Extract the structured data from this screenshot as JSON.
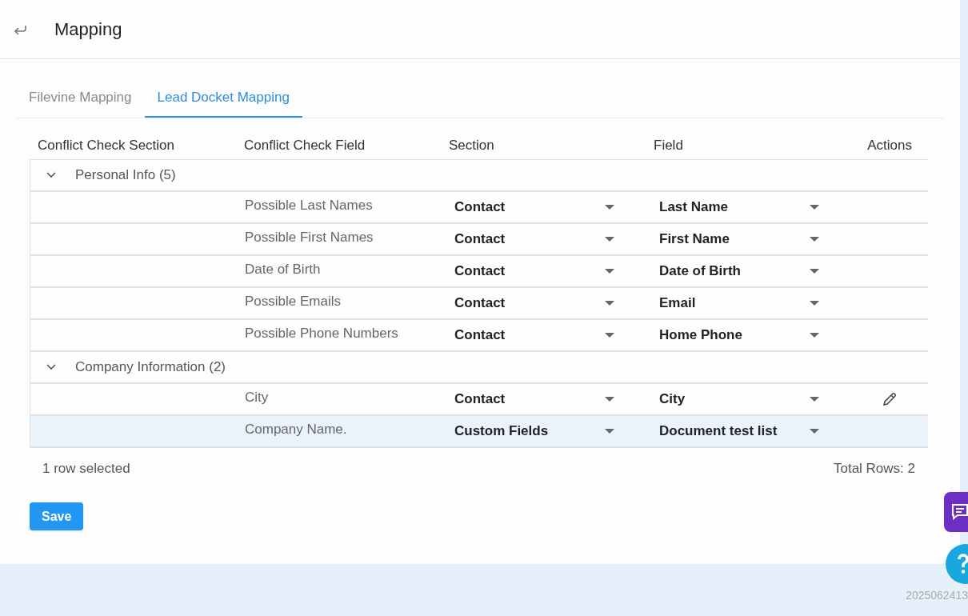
{
  "header": {
    "title": "Mapping"
  },
  "tabs": [
    {
      "label": "Filevine Mapping",
      "selected": false
    },
    {
      "label": "Lead Docket Mapping",
      "selected": true
    }
  ],
  "table": {
    "columns": [
      "Conflict Check Section",
      "Conflict Check Field",
      "Section",
      "Field",
      "Actions"
    ],
    "groups": [
      {
        "label": "Personal Info (5)",
        "expanded": true,
        "rows": [
          {
            "field": "Possible Last Names",
            "section": "Contact",
            "target": "Last Name",
            "selected": false,
            "edit_visible": false
          },
          {
            "field": "Possible First Names",
            "section": "Contact",
            "target": "First Name",
            "selected": false,
            "edit_visible": false
          },
          {
            "field": "Date of Birth",
            "section": "Contact",
            "target": "Date of Birth",
            "selected": false,
            "edit_visible": false
          },
          {
            "field": "Possible Emails",
            "section": "Contact",
            "target": "Email",
            "selected": false,
            "edit_visible": false
          },
          {
            "field": "Possible Phone Numbers",
            "section": "Contact",
            "target": "Home Phone",
            "selected": false,
            "edit_visible": false
          }
        ]
      },
      {
        "label": "Company Information (2)",
        "expanded": true,
        "rows": [
          {
            "field": "City",
            "section": "Contact",
            "target": "City",
            "selected": false,
            "edit_visible": true
          },
          {
            "field": "Company Name.",
            "section": "Custom Fields",
            "target": "Document test list",
            "selected": true,
            "edit_visible": false
          }
        ]
      }
    ]
  },
  "footer": {
    "selection": "1 row selected",
    "total": "Total Rows: 2"
  },
  "save_button": "Save",
  "version": "2025062413"
}
